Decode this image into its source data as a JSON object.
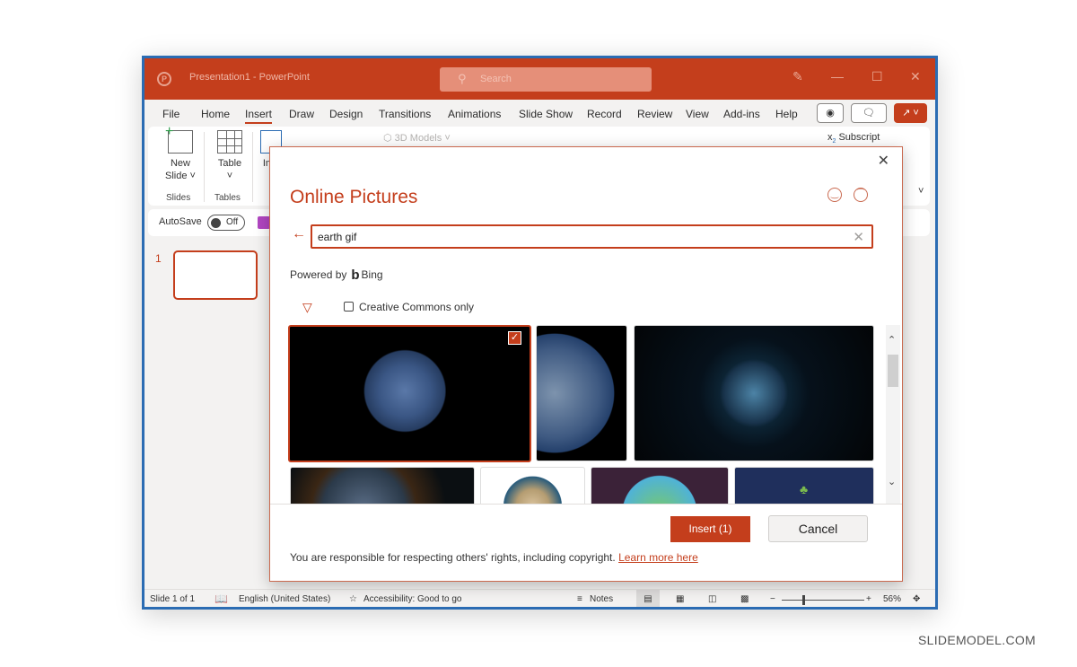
{
  "window": {
    "title": "Presentation1  -  PowerPoint",
    "search_placeholder": "Search"
  },
  "menu": {
    "items": [
      "File",
      "Home",
      "Insert",
      "Draw",
      "Design",
      "Transitions",
      "Animations",
      "Slide Show",
      "Record",
      "Review",
      "View",
      "Add-ins",
      "Help"
    ],
    "active": "Insert"
  },
  "ribbon": {
    "new_slide_label": "New",
    "new_slide_label2": "Slide ˅",
    "table_label": "Table",
    "table_chevron": "˅",
    "images_label": "Ima",
    "models_label": "3D Models",
    "subscript_label": "Subscript",
    "group_slides": "Slides",
    "group_tables": "Tables"
  },
  "autosave": {
    "label": "AutoSave",
    "state": "Off"
  },
  "slides_pane": {
    "slide_number": "1"
  },
  "dialog": {
    "title": "Online Pictures",
    "search_value": "earth gif",
    "powered_by": "Powered by",
    "provider": "Bing",
    "creative_commons_label": "Creative Commons only",
    "creative_commons_checked": false,
    "insert_button": "Insert (1)",
    "cancel_button": "Cancel",
    "rights_text": "You are responsible for respecting others' rights, including copyright.",
    "learn_more_link": "Learn more here",
    "images": [
      {
        "name": "earth-americas-black-background",
        "selected": true
      },
      {
        "name": "earth-asia-satellite",
        "selected": false
      },
      {
        "name": "earth-glowing-blue-space",
        "selected": false
      },
      {
        "name": "earth-sunrise-space",
        "selected": false
      },
      {
        "name": "earth-africa-europe",
        "selected": false
      },
      {
        "name": "cartoon-earth-purple",
        "selected": false
      },
      {
        "name": "cartoon-plant-navy",
        "selected": false
      }
    ]
  },
  "status": {
    "slide_info": "Slide 1 of 1",
    "language": "English (United States)",
    "accessibility": "Accessibility: Good to go",
    "notes": "Notes",
    "zoom_percent": "56%",
    "zoom_value": 56
  },
  "watermark": "SLIDEMODEL.COM",
  "colors": {
    "accent": "#c43e1c",
    "window_border": "#2b6cb3"
  }
}
